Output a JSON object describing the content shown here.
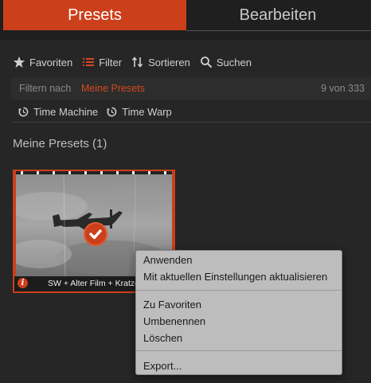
{
  "tabs": [
    {
      "label": "Presets",
      "active": true
    },
    {
      "label": "Bearbeiten",
      "active": false
    }
  ],
  "toolbar": {
    "favorites": {
      "label": "Favoriten",
      "icon": "star-icon"
    },
    "filter": {
      "label": "Filter",
      "icon": "list-filter-icon"
    },
    "sort": {
      "label": "Sortieren",
      "icon": "sort-icon"
    },
    "search": {
      "label": "Suchen",
      "icon": "search-icon"
    }
  },
  "filterbar": {
    "label": "Filtern nach",
    "value": "Meine Presets",
    "count": "9 von 333"
  },
  "chips": [
    {
      "label": "Time Machine",
      "icon": "rotate-arrow-icon"
    },
    {
      "label": "Time Warp",
      "icon": "rotate-arrow-icon"
    }
  ],
  "section": {
    "title": "Meine Presets (1)"
  },
  "preset": {
    "caption": "SW + Alter Film + Kratze",
    "info": "i",
    "selected": true
  },
  "context_menu": {
    "items": [
      "Anwenden",
      "Mit aktuellen Einstellungen aktualisieren",
      "Zu Favoriten",
      "Umbenennen",
      "Löschen",
      "Export..."
    ]
  },
  "colors": {
    "accent": "#cc3f1b",
    "background": "#262626",
    "menu_background": "#bdbdbd"
  }
}
